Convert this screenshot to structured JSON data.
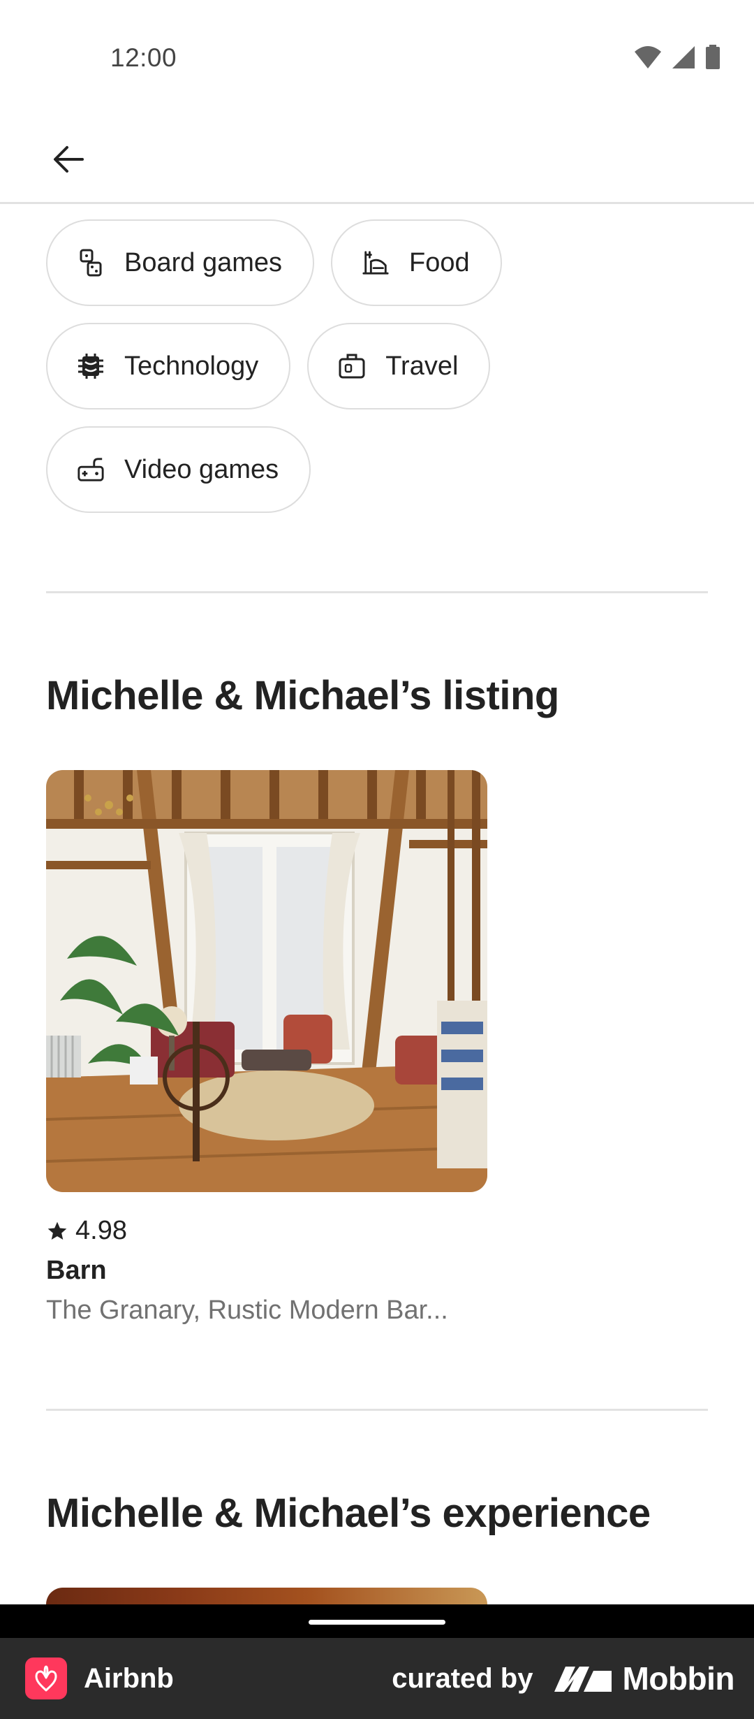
{
  "status_bar": {
    "time": "12:00"
  },
  "chips": [
    [
      {
        "label": "Board games",
        "icon": "dice-icon"
      },
      {
        "label": "Food",
        "icon": "food-icon"
      }
    ],
    [
      {
        "label": "Technology",
        "icon": "chip-icon"
      },
      {
        "label": "Travel",
        "icon": "luggage-icon"
      }
    ],
    [
      {
        "label": "Video games",
        "icon": "gamepad-icon"
      }
    ]
  ],
  "listing_section": {
    "title": "Michelle & Michael’s listing",
    "card": {
      "rating": "4.98",
      "type": "Barn",
      "description": "The Granary, Rustic Modern Bar..."
    }
  },
  "experience_section": {
    "title": "Michelle & Michael’s experience"
  },
  "footer": {
    "app_name": "Airbnb",
    "curated_by": "curated by",
    "brand": "Mobbin"
  },
  "colors": {
    "accent": "#ff385c",
    "text": "#222222",
    "muted": "#717171",
    "divider": "#e2e2e2"
  }
}
